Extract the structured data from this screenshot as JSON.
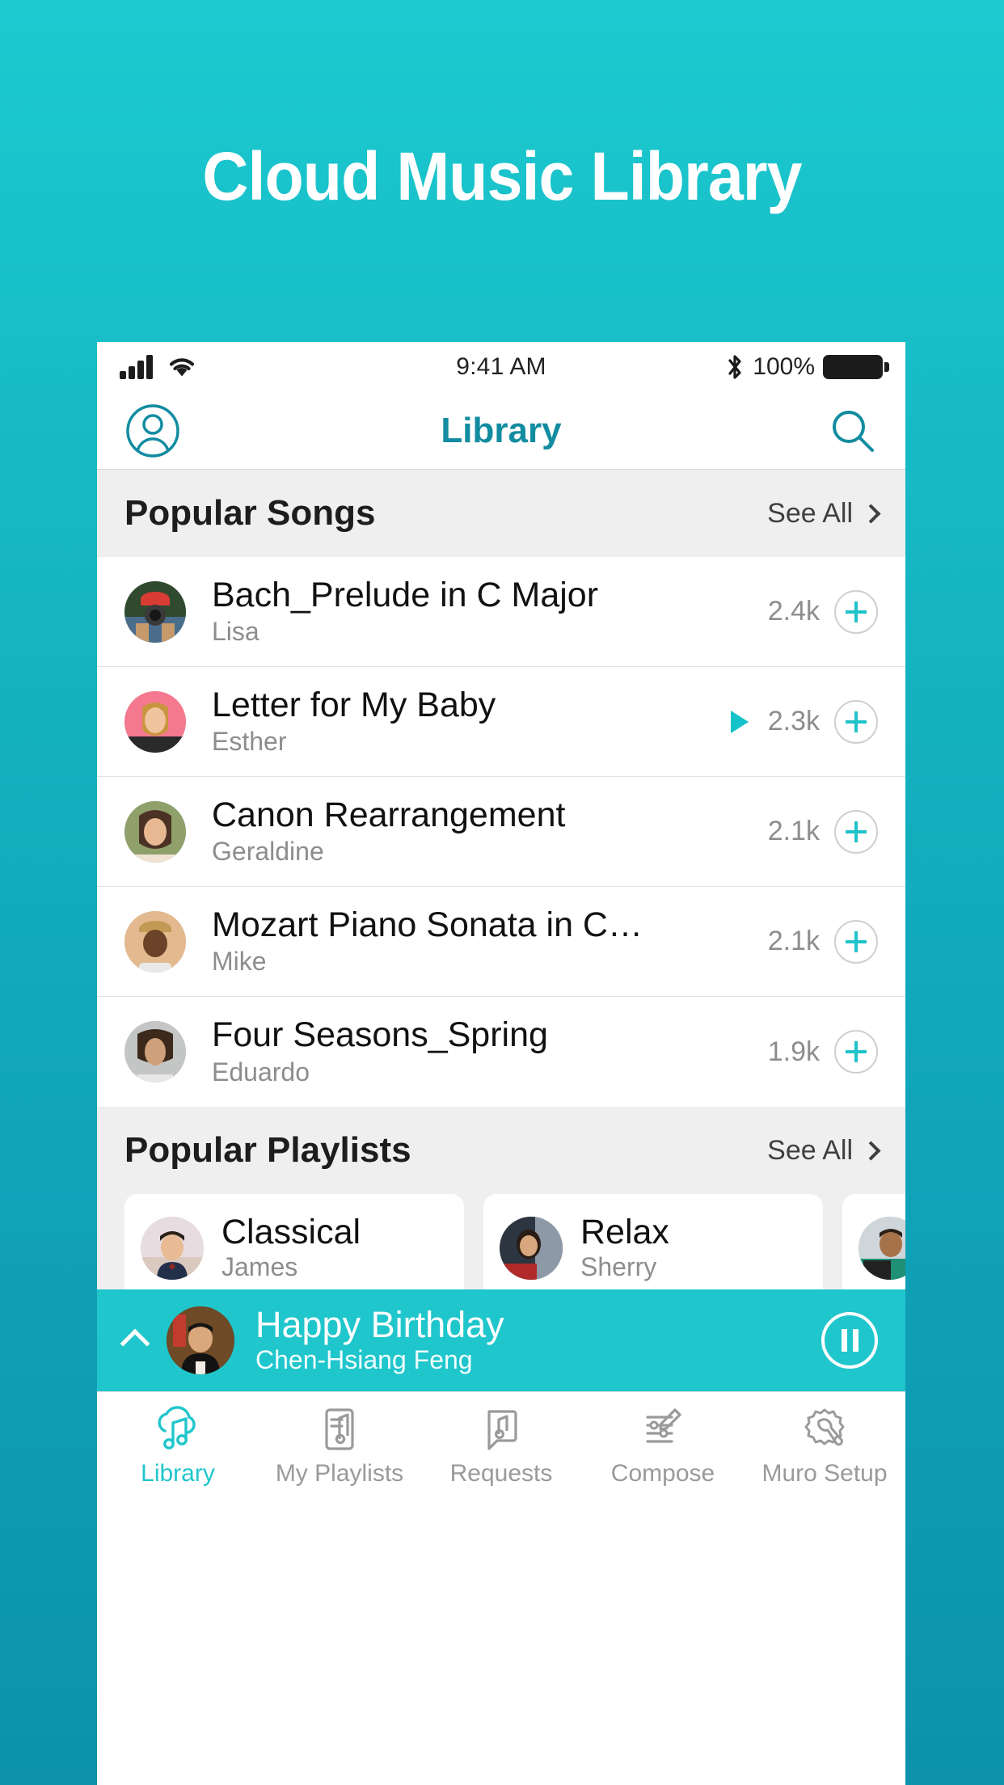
{
  "hero": {
    "title": "Cloud Music Library"
  },
  "theme": {
    "accent": "#1fc6cc",
    "nav_title_color": "#128ca0",
    "bg_top": "#1ccad0",
    "bg_bottom": "#0c92ab"
  },
  "status_bar": {
    "signal_icon": "cellular-signal-icon",
    "wifi_icon": "wifi-icon",
    "time": "9:41 AM",
    "bluetooth_icon": "bluetooth-icon",
    "battery_text": "100%",
    "battery_icon": "battery-full-icon"
  },
  "nav": {
    "profile_icon": "account-circle-icon",
    "title": "Library",
    "search_icon": "search-icon"
  },
  "sections": [
    {
      "title": "Popular Songs",
      "see_all": "See All",
      "chevron_icon": "chevron-right-icon"
    },
    {
      "title": "Popular Playlists",
      "see_all": "See All",
      "chevron_icon": "chevron-right-icon"
    }
  ],
  "songs": [
    {
      "title": "Bach_Prelude in C Major",
      "artist": "Lisa",
      "plays": "2.4k",
      "playing": false,
      "avatar": "avatar-lisa",
      "add_icon": "plus-circle-icon"
    },
    {
      "title": "Letter for My Baby",
      "artist": "Esther",
      "plays": "2.3k",
      "playing": true,
      "avatar": "avatar-esther",
      "add_icon": "plus-circle-icon"
    },
    {
      "title": "Canon Rearrangement",
      "artist": "Geraldine",
      "plays": "2.1k",
      "playing": false,
      "avatar": "avatar-geraldine",
      "add_icon": "plus-circle-icon"
    },
    {
      "title": "Mozart Piano Sonata in C…",
      "artist": "Mike",
      "plays": "2.1k",
      "playing": false,
      "avatar": "avatar-mike",
      "add_icon": "plus-circle-icon"
    },
    {
      "title": "Four Seasons_Spring",
      "artist": "Eduardo",
      "plays": "1.9k",
      "playing": false,
      "avatar": "avatar-eduardo",
      "add_icon": "plus-circle-icon"
    }
  ],
  "playlists": [
    {
      "name": "Classical",
      "owner": "James",
      "avatar": "avatar-james"
    },
    {
      "name": "Relax",
      "owner": "Sherry",
      "avatar": "avatar-sherry"
    },
    {
      "name": "",
      "owner": "",
      "avatar": "avatar-third"
    }
  ],
  "now_playing": {
    "expand_icon": "chevron-up-icon",
    "title": "Happy Birthday",
    "artist": "Chen-Hsiang Feng",
    "avatar": "avatar-chen-hsiang-feng",
    "pause_icon": "pause-circle-icon"
  },
  "tabs": [
    {
      "label": "Library",
      "icon": "cloud-music-icon",
      "active": true
    },
    {
      "label": "My Playlists",
      "icon": "playlist-note-icon",
      "active": false
    },
    {
      "label": "Requests",
      "icon": "request-note-icon",
      "active": false
    },
    {
      "label": "Compose",
      "icon": "compose-icon",
      "active": false
    },
    {
      "label": "Muro Setup",
      "icon": "gear-wrench-icon",
      "active": false
    }
  ]
}
